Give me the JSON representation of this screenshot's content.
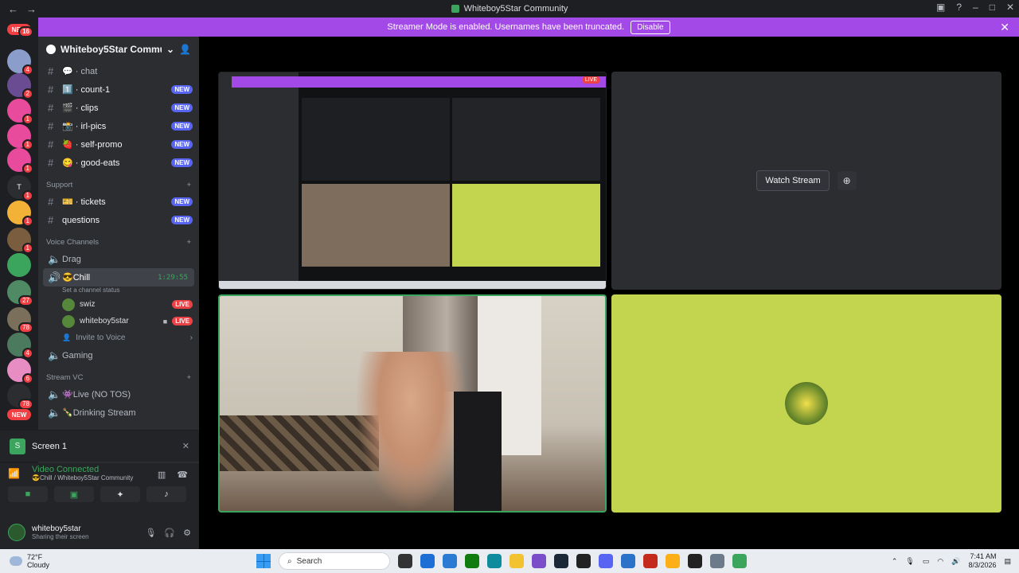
{
  "window": {
    "title": "Whiteboy5Star Community"
  },
  "banner": {
    "text": "Streamer Mode is enabled. Usernames have been truncated.",
    "button": "Disable"
  },
  "servers": [
    {
      "label": "NEW",
      "badge": "16"
    },
    {
      "label": "",
      "badge": "4"
    },
    {
      "label": "",
      "badge": "2"
    },
    {
      "label": "",
      "badge": "1"
    },
    {
      "label": "",
      "badge": "1"
    },
    {
      "label": "",
      "badge": "1"
    },
    {
      "label": "T",
      "badge": "1"
    },
    {
      "label": "",
      "badge": "1"
    },
    {
      "label": "",
      "badge": "1"
    },
    {
      "label": "",
      "badge": ""
    },
    {
      "label": "",
      "badge": "27"
    },
    {
      "label": "",
      "badge": "78"
    },
    {
      "label": "",
      "badge": "4"
    },
    {
      "label": "",
      "badge": "6"
    },
    {
      "label": "",
      "badge": "78"
    },
    {
      "label": "NEW",
      "badge": ""
    }
  ],
  "guild": {
    "name": "Whiteboy5Star Communi..."
  },
  "channels": [
    {
      "name": "chat",
      "emoji": "💬",
      "new": ""
    },
    {
      "name": "count-1",
      "emoji": "1️⃣",
      "new": "NEW"
    },
    {
      "name": "clips",
      "emoji": "🎬",
      "new": "NEW"
    },
    {
      "name": "irl-pics",
      "emoji": "📸",
      "new": "NEW"
    },
    {
      "name": "self-promo",
      "emoji": "🍓",
      "new": "NEW"
    },
    {
      "name": "good-eats",
      "emoji": "😋",
      "new": "NEW"
    }
  ],
  "support": {
    "category": "Support",
    "channels": [
      {
        "name": "tickets",
        "emoji": "🎫",
        "new": "NEW"
      },
      {
        "name": "questions",
        "new": "NEW"
      }
    ]
  },
  "voice": {
    "category": "Voice Channels",
    "channels": [
      {
        "name": "Drag"
      },
      {
        "name": "Chill",
        "emoji": "😎",
        "timer": "1:29:55",
        "status": "Set a channel status"
      }
    ],
    "users": [
      {
        "name": "swiz",
        "tag": "LIVE"
      },
      {
        "name": "whiteboy5star",
        "tag": "LIVE"
      }
    ],
    "invite": "Invite to Voice",
    "gaming": "Gaming"
  },
  "streamvc": {
    "category": "Stream VC",
    "channels": [
      {
        "name": "Live (NO TOS)",
        "emoji": "👾"
      },
      {
        "name": "Drinking Stream",
        "emoji": "🍾"
      }
    ]
  },
  "screen": {
    "label": "Screen 1"
  },
  "connection": {
    "status": "Video Connected",
    "location": "😎Chill / Whiteboy5Star Community"
  },
  "account": {
    "name": "whiteboy5star",
    "status": "Sharing their screen"
  },
  "stream": {
    "watch_label": "Watch Stream"
  },
  "taskbar": {
    "temp": "72°F",
    "weather": "Cloudy",
    "search": "Search",
    "time": "7:41 AM",
    "date": "8/3/2026"
  }
}
